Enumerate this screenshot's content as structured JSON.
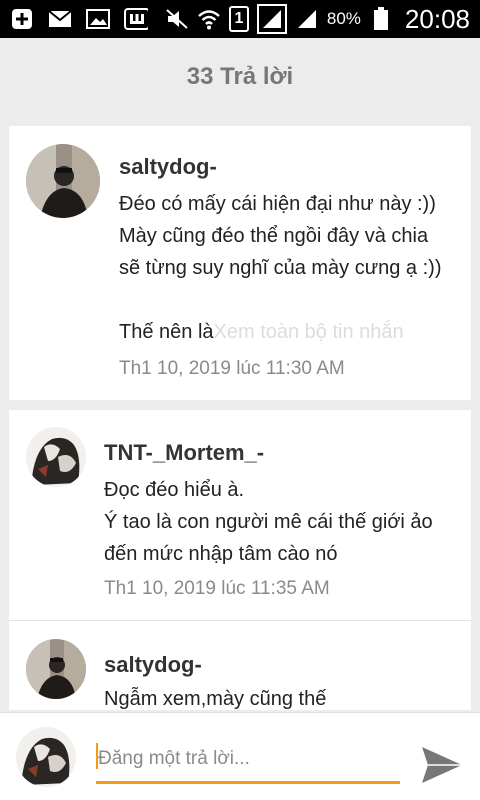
{
  "status_bar": {
    "battery_percent": "80%",
    "time": "20:08",
    "sim": "1",
    "icons": [
      "plus-icon",
      "mail-icon",
      "gallery-icon",
      "keyboard-icon",
      "mute-icon",
      "wifi-icon",
      "sim-1-icon",
      "signal-icon",
      "signal-icon",
      "battery-icon"
    ]
  },
  "header": {
    "title": "33 Trả lời"
  },
  "messages": [
    {
      "username": "saltydog-",
      "lines": [
        "Đéo có mấy cái hiện đại như này :))",
        "Mày cũng đéo thể ngồi đây và chia",
        "sẽ từng suy nghĩ của mày cưng ạ :))",
        "",
        "Thế nên là"
      ],
      "more_link": "Xem toàn bộ tin nhắn",
      "timestamp": "Th1 10, 2019 lúc 11:30 AM"
    },
    {
      "username": "TNT-_Mortem_-",
      "lines": [
        "Đọc đéo hiểu à.",
        "Ý tao là con người mê cái thế giới ảo",
        "đến mức nhập tâm cào nó"
      ],
      "timestamp": "Th1 10, 2019 lúc 11:35 AM"
    },
    {
      "username": "saltydog-",
      "lines": [
        "Ngẫm xem,mày cũng thế"
      ]
    }
  ],
  "compose": {
    "placeholder": "Đăng một trả lời..."
  },
  "colors": {
    "accent": "#f39c12",
    "header_text": "#777777",
    "timestamp": "#8a8a8a",
    "background": "#ececec"
  }
}
